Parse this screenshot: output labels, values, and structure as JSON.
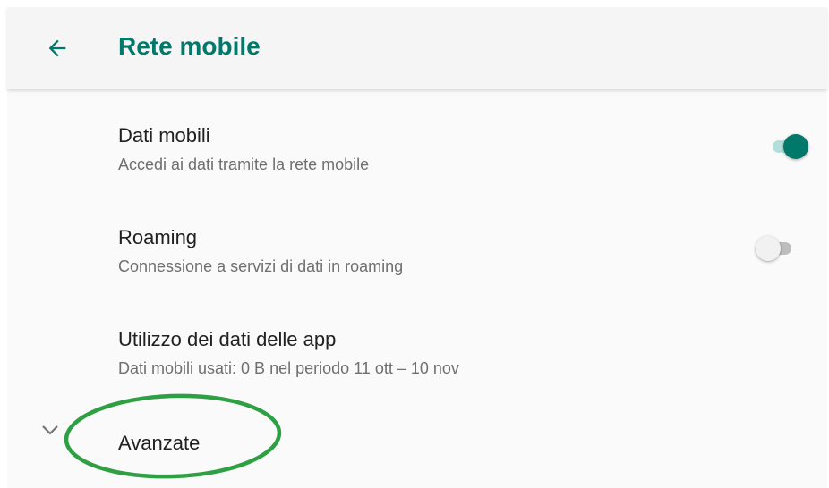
{
  "header": {
    "back_icon": "arrow-left-icon",
    "title": "Rete mobile"
  },
  "settings": [
    {
      "title": "Dati mobili",
      "subtitle": "Accedi ai dati tramite la rete mobile",
      "toggle": "on"
    },
    {
      "title": "Roaming",
      "subtitle": "Connessione a servizi di dati in roaming",
      "toggle": "off"
    },
    {
      "title": "Utilizzo dei dati delle app",
      "subtitle": "Dati mobili usati: 0 B nel periodo 11 ott – 10 nov"
    }
  ],
  "advanced": {
    "label": "Avanzate",
    "icon": "chevron-down-icon"
  },
  "colors": {
    "accent": "#00796b",
    "accent_light": "#b2dfdb",
    "highlight": "#2ea043"
  }
}
